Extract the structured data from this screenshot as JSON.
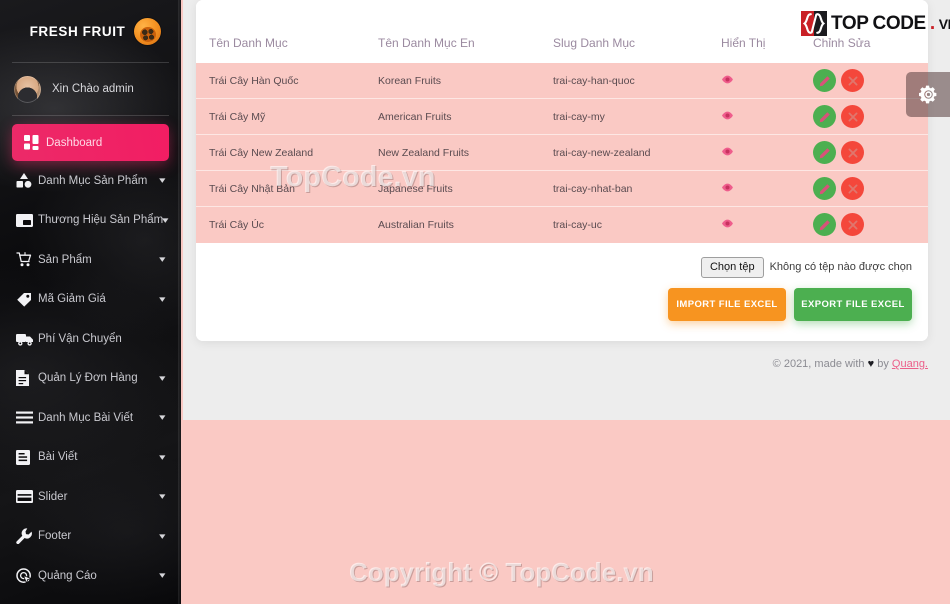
{
  "brand": {
    "name": "FRESH FRUIT",
    "logo_icon": "orange-fruit-icon"
  },
  "user": {
    "greeting": "Xin Chào admin"
  },
  "sidebar": {
    "items": [
      {
        "label": "Dashboard",
        "icon": "dashboard-grid-icon",
        "active": true,
        "caret": false
      },
      {
        "label": "Danh Mục Sản Phẩm",
        "icon": "shapes-icon",
        "active": false,
        "caret": true
      },
      {
        "label": "Thương Hiệu Sản Phẩm",
        "icon": "window-icon",
        "active": false,
        "caret": true
      },
      {
        "label": "Sản Phẩm",
        "icon": "cart-icon",
        "active": false,
        "caret": true
      },
      {
        "label": "Mã Giảm Giá",
        "icon": "tag-icon",
        "active": false,
        "caret": true
      },
      {
        "label": "Phí Vận Chuyển",
        "icon": "truck-icon",
        "active": false,
        "caret": false
      },
      {
        "label": "Quản Lý Đơn Hàng",
        "icon": "document-icon",
        "active": false,
        "caret": true
      },
      {
        "label": "Danh Mục Bài Viết",
        "icon": "list-lines-icon",
        "active": false,
        "caret": true
      },
      {
        "label": "Bài Viết",
        "icon": "article-icon",
        "active": false,
        "caret": true
      },
      {
        "label": "Slider",
        "icon": "slider-card-icon",
        "active": false,
        "caret": true
      },
      {
        "label": "Footer",
        "icon": "wrench-icon",
        "active": false,
        "caret": true
      },
      {
        "label": "Quảng Cáo",
        "icon": "target-cursor-icon",
        "active": false,
        "caret": true
      }
    ]
  },
  "table": {
    "headers": [
      "Tên Danh Mục",
      "Tên Danh Mục En",
      "Slug Danh Mục",
      "Hiển Thị",
      "Chỉnh Sửa"
    ],
    "rows": [
      {
        "name": "Trái Cây Hàn Quốc",
        "name_en": "Korean Fruits",
        "slug": "trai-cay-han-quoc"
      },
      {
        "name": "Trái Cây Mỹ",
        "name_en": "American Fruits",
        "slug": "trai-cay-my"
      },
      {
        "name": "Trái Cây New Zealand",
        "name_en": "New Zealand Fruits",
        "slug": "trai-cay-new-zealand"
      },
      {
        "name": "Trái Cây Nhật Bản",
        "name_en": "Japanese Fruits",
        "slug": "trai-cay-nhat-ban"
      },
      {
        "name": "Trái Cây Úc",
        "name_en": "Australian Fruits",
        "slug": "trai-cay-uc"
      }
    ],
    "row_icons": {
      "show": "eye-icon",
      "edit": "pencil-icon",
      "delete": "close-x-icon"
    }
  },
  "file_upload": {
    "button_label": "Chọn tệp",
    "status_text": "Không có tệp nào được chọn"
  },
  "actions": {
    "import_label": "IMPORT FILE EXCEL",
    "export_label": "EXPORT FILE EXCEL"
  },
  "footer": {
    "prefix": "© 2021, made with",
    "heart": "♥",
    "by": "by",
    "author": "Quang."
  },
  "settings": {
    "icon": "gear-icon"
  },
  "watermarks": {
    "middle": "TopCode.vn",
    "bottom": "Copyright © TopCode.vn"
  },
  "topcode_logo": {
    "badge": "{/}",
    "top": "TOP",
    "code": "CODE",
    "dot": ".",
    "vn": "VN"
  },
  "colors": {
    "accent_pink": "#ec2a68",
    "page_pink": "#fac9c4",
    "gray_bg": "#ededed",
    "green": "#4caf50",
    "red": "#f4473b",
    "orange": "#f79420"
  }
}
